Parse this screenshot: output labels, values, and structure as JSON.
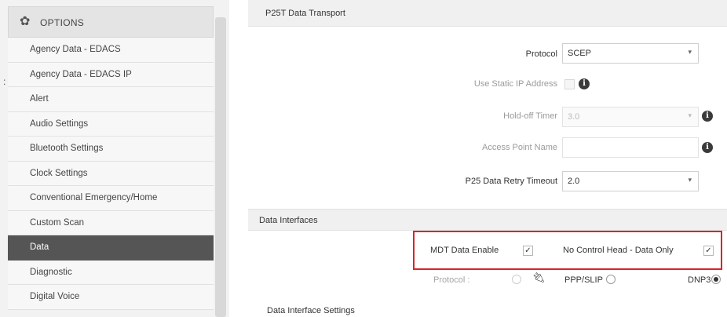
{
  "sidebar": {
    "title": "OPTIONS",
    "gear_icon": "gear-icon",
    "items": [
      {
        "label": "Agency Data - EDACS"
      },
      {
        "label": "Agency Data - EDACS IP"
      },
      {
        "label": "Alert"
      },
      {
        "label": "Audio Settings"
      },
      {
        "label": "Bluetooth Settings"
      },
      {
        "label": "Clock Settings"
      },
      {
        "label": "Conventional Emergency/Home"
      },
      {
        "label": "Custom Scan"
      },
      {
        "label": "Data"
      },
      {
        "label": "Diagnostic"
      },
      {
        "label": "Digital Voice"
      }
    ],
    "active_item": "Data"
  },
  "p25t": {
    "section_title": "P25T Data Transport",
    "protocol_label": "Protocol",
    "protocol_value": "SCEP",
    "static_ip_label": "Use Static IP Address",
    "holdoff_label": "Hold-off Timer",
    "holdoff_value": "3.0",
    "apn_label": "Access Point Name",
    "apn_value": "",
    "retry_label": "P25 Data Retry Timeout",
    "retry_value": "2.0"
  },
  "interfaces": {
    "section_title": "Data Interfaces",
    "mdt_label": "MDT Data Enable",
    "mdt_checked": true,
    "nch_label": "No Control Head - Data Only",
    "nch_checked": true,
    "protocol_label": "Protocol :",
    "ppp_label": "PPP/SLIP",
    "dnp3_label": "DNP3",
    "selected_protocol": "DNP3",
    "settings_title": "Data Interface Settings"
  },
  "colors": {
    "active_bg": "#555555",
    "highlight_border": "#d9242b"
  }
}
